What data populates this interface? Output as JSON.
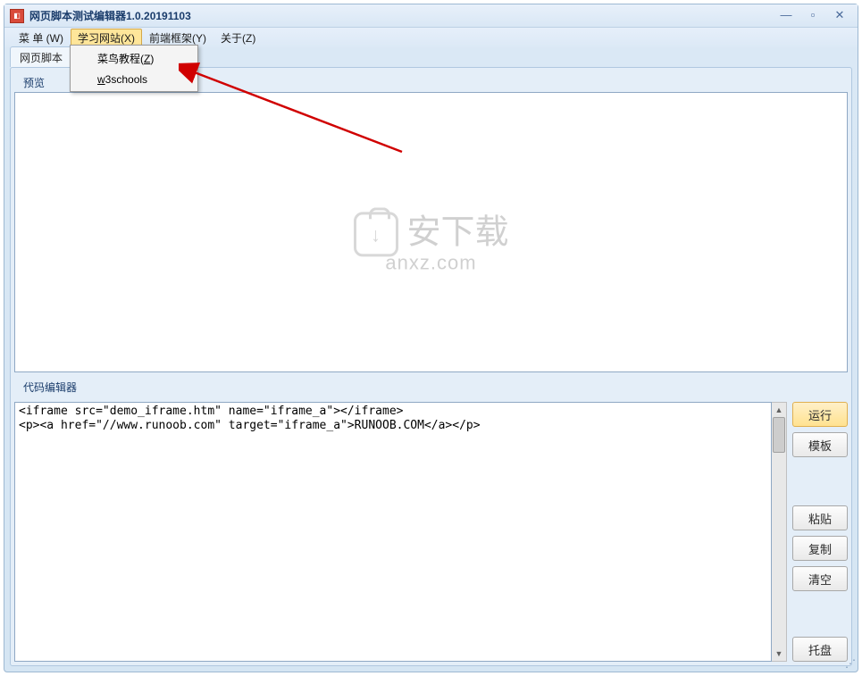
{
  "window": {
    "title": "网页脚本测试编辑器1.0.20191103",
    "controls": {
      "minimize": "—",
      "maximize": "▫",
      "close": "✕"
    }
  },
  "menubar": {
    "items": [
      {
        "label": "菜 单 (W)"
      },
      {
        "label": "学习网站(X)",
        "active": true
      },
      {
        "label": "前端框架(Y)"
      },
      {
        "label": "关于(Z)"
      }
    ]
  },
  "dropdown": {
    "items": [
      {
        "label": "菜鸟教程(Z)",
        "ul_char": "Z"
      },
      {
        "label": "w3schools",
        "ul_char": "w"
      }
    ]
  },
  "tab": {
    "label": "网页脚本"
  },
  "sections": {
    "preview": "预览",
    "code": "代码编辑器"
  },
  "code": "<iframe src=\"demo_iframe.htm\" name=\"iframe_a\"></iframe>\n<p><a href=\"//www.runoob.com\" target=\"iframe_a\">RUNOOB.COM</a></p>",
  "buttons": {
    "run": "运行",
    "template": "模板",
    "paste": "粘贴",
    "copy": "复制",
    "clear": "清空",
    "tray": "托盘"
  },
  "watermark": {
    "line1": "安下载",
    "line2": "anxz.com"
  }
}
